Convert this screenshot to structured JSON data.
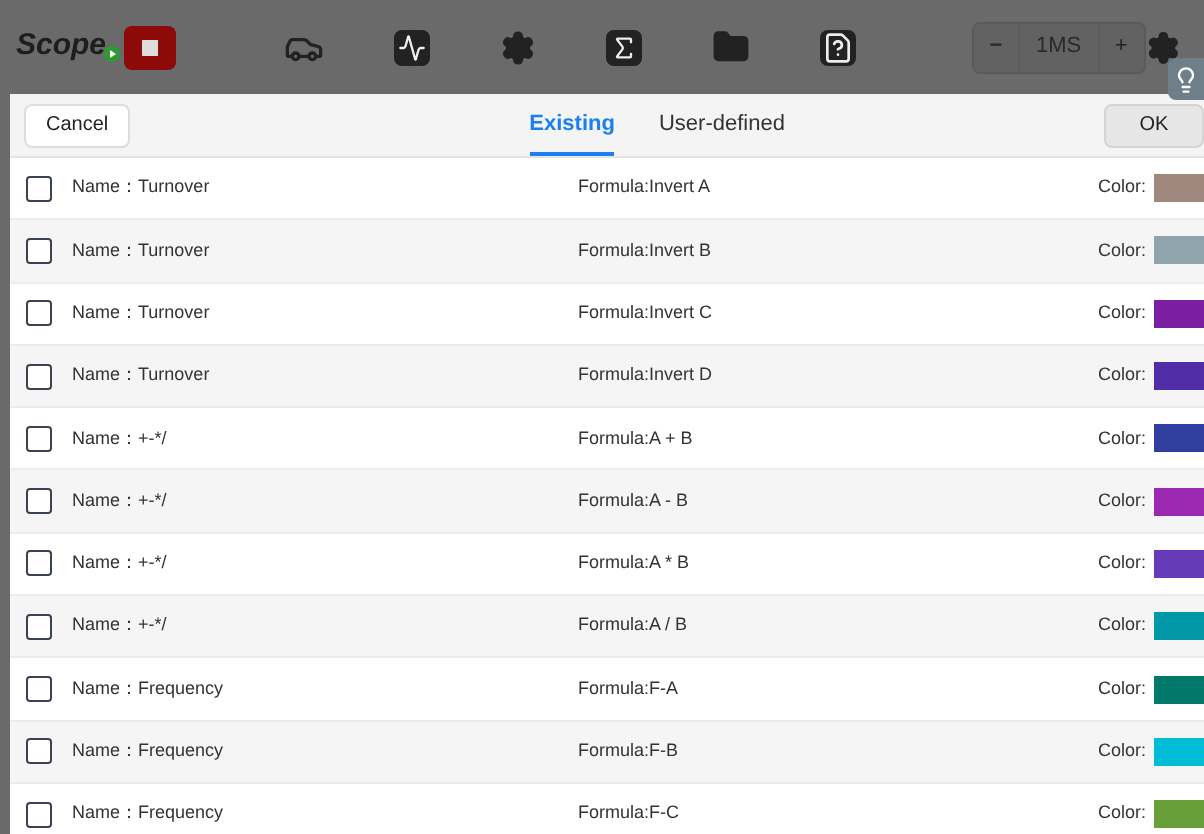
{
  "toolbar": {
    "app_title": "Scope",
    "timebase": {
      "minus": "−",
      "value": "1MS",
      "plus": "+"
    }
  },
  "dialog": {
    "cancel": "Cancel",
    "ok": "OK",
    "tabs": [
      {
        "label": "Existing",
        "selected": true
      },
      {
        "label": "User-defined",
        "selected": false
      }
    ],
    "rows": [
      {
        "name": "Name：Turnover",
        "formula": "Formula:Invert A",
        "color_label": "Color:",
        "color": "#a1887f",
        "checked": false
      },
      {
        "name": "Name：Turnover",
        "formula": "Formula:Invert B",
        "color_label": "Color:",
        "color": "#90a4ae",
        "checked": false
      },
      {
        "name": "Name：Turnover",
        "formula": "Formula:Invert C",
        "color_label": "Color:",
        "color": "#7b1fa2",
        "checked": false
      },
      {
        "name": "Name：Turnover",
        "formula": "Formula:Invert D",
        "color_label": "Color:",
        "color": "#512da8",
        "checked": false
      },
      {
        "name": "Name：+-*/",
        "formula": "Formula:A + B",
        "color_label": "Color:",
        "color": "#303f9f",
        "checked": false
      },
      {
        "name": "Name：+-*/",
        "formula": "Formula:A - B",
        "color_label": "Color:",
        "color": "#9c27b0",
        "checked": false
      },
      {
        "name": "Name：+-*/",
        "formula": "Formula:A * B",
        "color_label": "Color:",
        "color": "#673ab7",
        "checked": false
      },
      {
        "name": "Name：+-*/",
        "formula": "Formula:A / B",
        "color_label": "Color:",
        "color": "#0097a7",
        "checked": false
      },
      {
        "name": "Name：Frequency",
        "formula": "Formula:F-A",
        "color_label": "Color:",
        "color": "#00796b",
        "checked": false
      },
      {
        "name": "Name：Frequency",
        "formula": "Formula:F-B",
        "color_label": "Color:",
        "color": "#00bcd4",
        "checked": false
      },
      {
        "name": "Name：Frequency",
        "formula": "Formula:F-C",
        "color_label": "Color:",
        "color": "#689f38",
        "checked": false
      }
    ]
  }
}
